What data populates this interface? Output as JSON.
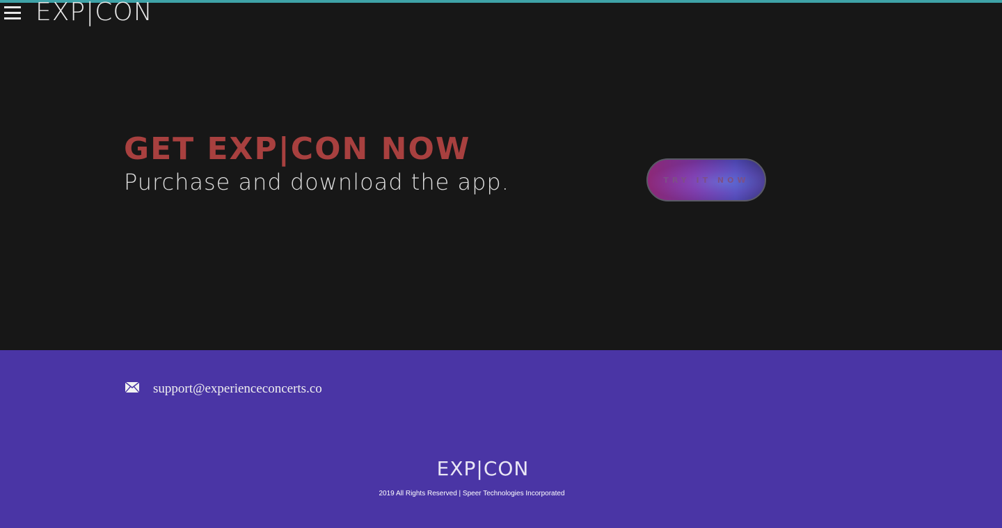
{
  "header": {
    "menu_icon": "hamburger-menu-icon",
    "logo": "EXP|CON"
  },
  "hero": {
    "title": "GET EXP|CON NOW",
    "subtitle": "Purchase and download the app.",
    "cta_label": "TRY IT NOW"
  },
  "footer": {
    "mail_icon": "envelope-icon",
    "email": "support@experienceconcerts.co",
    "logo": "EXP|CON",
    "copyright": "2019 All Rights Reserved | Speer Technologies Incorporated"
  },
  "colors": {
    "accent_bar": "#3fa3a8",
    "background": "#171717",
    "hero_title": "#a8403f",
    "footer_bg": "#4a35a5"
  }
}
